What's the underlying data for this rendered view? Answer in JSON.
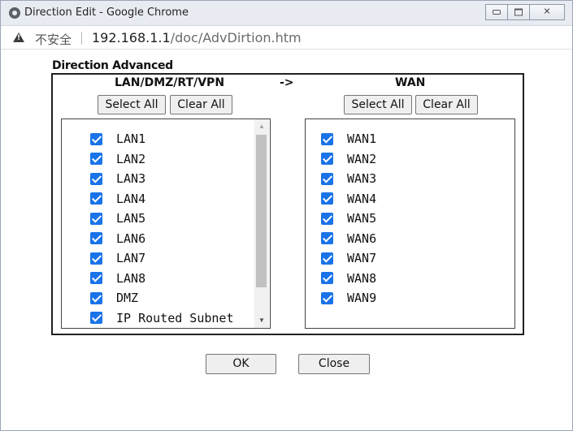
{
  "window": {
    "title": "Direction Edit - Google Chrome",
    "controls": {
      "minimize": "minimize",
      "maximize": "maximize",
      "close": "✕"
    }
  },
  "address_bar": {
    "security_label": "不安全",
    "host": "192.168.1.1",
    "path": "/doc/AdvDirtion.htm"
  },
  "section": {
    "title": "Direction Advanced"
  },
  "source": {
    "header": "LAN/DMZ/RT/VPN",
    "select_all": "Select All",
    "clear_all": "Clear All",
    "items": [
      {
        "label": "LAN1",
        "checked": true
      },
      {
        "label": "LAN2",
        "checked": true
      },
      {
        "label": "LAN3",
        "checked": true
      },
      {
        "label": "LAN4",
        "checked": true
      },
      {
        "label": "LAN5",
        "checked": true
      },
      {
        "label": "LAN6",
        "checked": true
      },
      {
        "label": "LAN7",
        "checked": true
      },
      {
        "label": "LAN8",
        "checked": true
      },
      {
        "label": "DMZ",
        "checked": true
      },
      {
        "label": "IP Routed Subnet",
        "checked": true
      }
    ]
  },
  "arrow": "->",
  "destination": {
    "header": "WAN",
    "select_all": "Select All",
    "clear_all": "Clear All",
    "items": [
      {
        "label": "WAN1",
        "checked": true
      },
      {
        "label": "WAN2",
        "checked": true
      },
      {
        "label": "WAN3",
        "checked": true
      },
      {
        "label": "WAN4",
        "checked": true
      },
      {
        "label": "WAN5",
        "checked": true
      },
      {
        "label": "WAN6",
        "checked": true
      },
      {
        "label": "WAN7",
        "checked": true
      },
      {
        "label": "WAN8",
        "checked": true
      },
      {
        "label": "WAN9",
        "checked": true
      }
    ]
  },
  "footer": {
    "ok": "OK",
    "close": "Close"
  },
  "colors": {
    "checkbox": "#1a73e8",
    "titlebar": "#e8ecf2"
  },
  "icons": {
    "site_info": "warning-icon",
    "app": "chrome-icon"
  }
}
